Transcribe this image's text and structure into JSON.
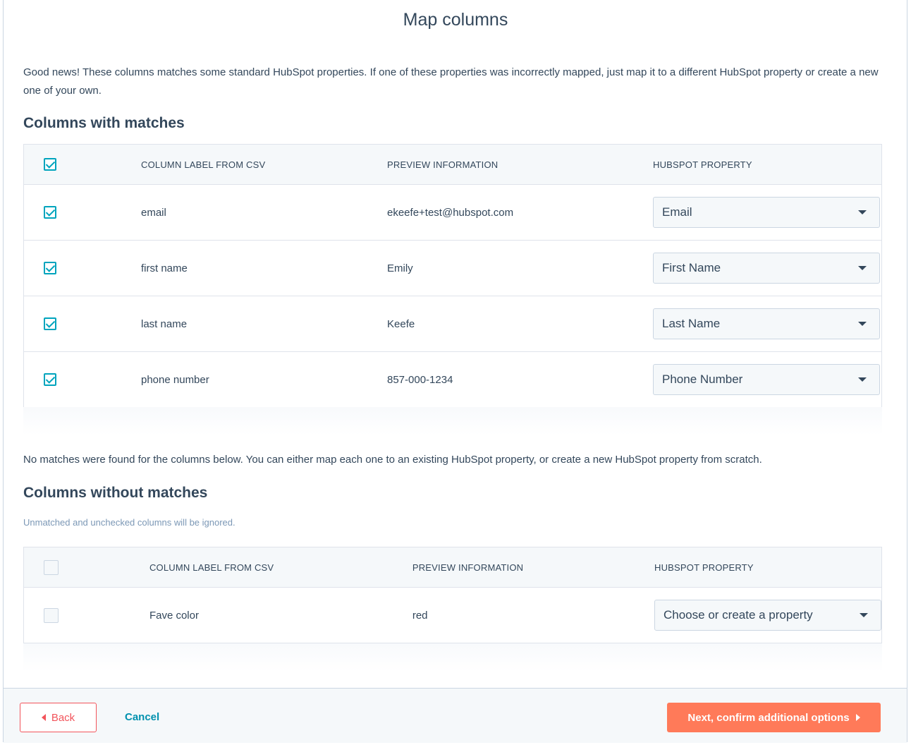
{
  "page": {
    "title": "Map columns",
    "intro": "Good news! These columns matches some standard HubSpot properties. If one of these properties was incorrectly mapped, just map it to a different HubSpot property or create a new one of your own."
  },
  "matched": {
    "heading": "Columns with matches",
    "headers": {
      "label": "COLUMN LABEL FROM CSV",
      "preview": "PREVIEW INFORMATION",
      "property": "HUBSPOT PROPERTY"
    },
    "rows": [
      {
        "label": "email",
        "preview": "ekeefe+test@hubspot.com",
        "property": "Email"
      },
      {
        "label": "first name",
        "preview": "Emily",
        "property": "First Name"
      },
      {
        "label": "last name",
        "preview": "Keefe",
        "property": "Last Name"
      },
      {
        "label": "phone number",
        "preview": "857-000-1234",
        "property": "Phone Number"
      }
    ]
  },
  "unmatched": {
    "note": "No matches were found for the columns below. You can either map each one to an existing HubSpot property, or create a new HubSpot property from scratch.",
    "heading": "Columns without matches",
    "hint": "Unmatched and unchecked columns will be ignored.",
    "headers": {
      "label": "COLUMN LABEL FROM CSV",
      "preview": "PREVIEW INFORMATION",
      "property": "HUBSPOT PROPERTY"
    },
    "rows": [
      {
        "label": "Fave color",
        "preview": "red",
        "property": "Choose or create a property"
      }
    ]
  },
  "footer": {
    "back_label": "Back",
    "cancel_label": "Cancel",
    "next_label": "Next, confirm additional options"
  },
  "colors": {
    "accent_teal": "#00a4bd",
    "primary_orange": "#ff7a59",
    "back_red": "#f2545b",
    "link_blue": "#0091ae",
    "text": "#33475b"
  }
}
